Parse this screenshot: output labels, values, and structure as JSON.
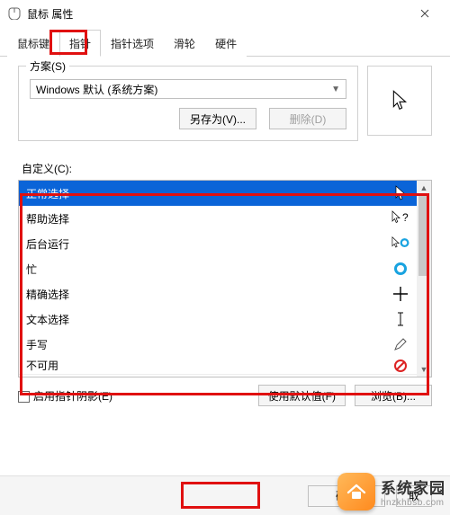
{
  "titlebar": {
    "title": "鼠标 属性"
  },
  "tabs": {
    "items": [
      {
        "label": "鼠标键"
      },
      {
        "label": "指针"
      },
      {
        "label": "指针选项"
      },
      {
        "label": "滑轮"
      },
      {
        "label": "硬件"
      }
    ],
    "active": 1
  },
  "scheme": {
    "group_label": "方案(S)",
    "selected": "Windows 默认 (系统方案)",
    "save_as": "另存为(V)...",
    "delete": "删除(D)"
  },
  "customize": {
    "label": "自定义(C):"
  },
  "cursors": [
    {
      "name": "正常选择",
      "icon": "arrow",
      "selected": true
    },
    {
      "name": "帮助选择",
      "icon": "arrow-help"
    },
    {
      "name": "后台运行",
      "icon": "arrow-busy"
    },
    {
      "name": "忙",
      "icon": "busy"
    },
    {
      "name": "精确选择",
      "icon": "crosshair"
    },
    {
      "name": "文本选择",
      "icon": "ibeam"
    },
    {
      "name": "手写",
      "icon": "pen"
    },
    {
      "name": "不可用",
      "icon": "no"
    }
  ],
  "shadow": {
    "label": "启用指针阴影(E)",
    "checked": false
  },
  "buttons": {
    "use_default": "使用默认值(F)",
    "browse": "浏览(B)...",
    "ok": "确定",
    "cancel": "取"
  },
  "watermark": {
    "line1": "系统家园",
    "line2": "hnzkhbsb.com"
  }
}
